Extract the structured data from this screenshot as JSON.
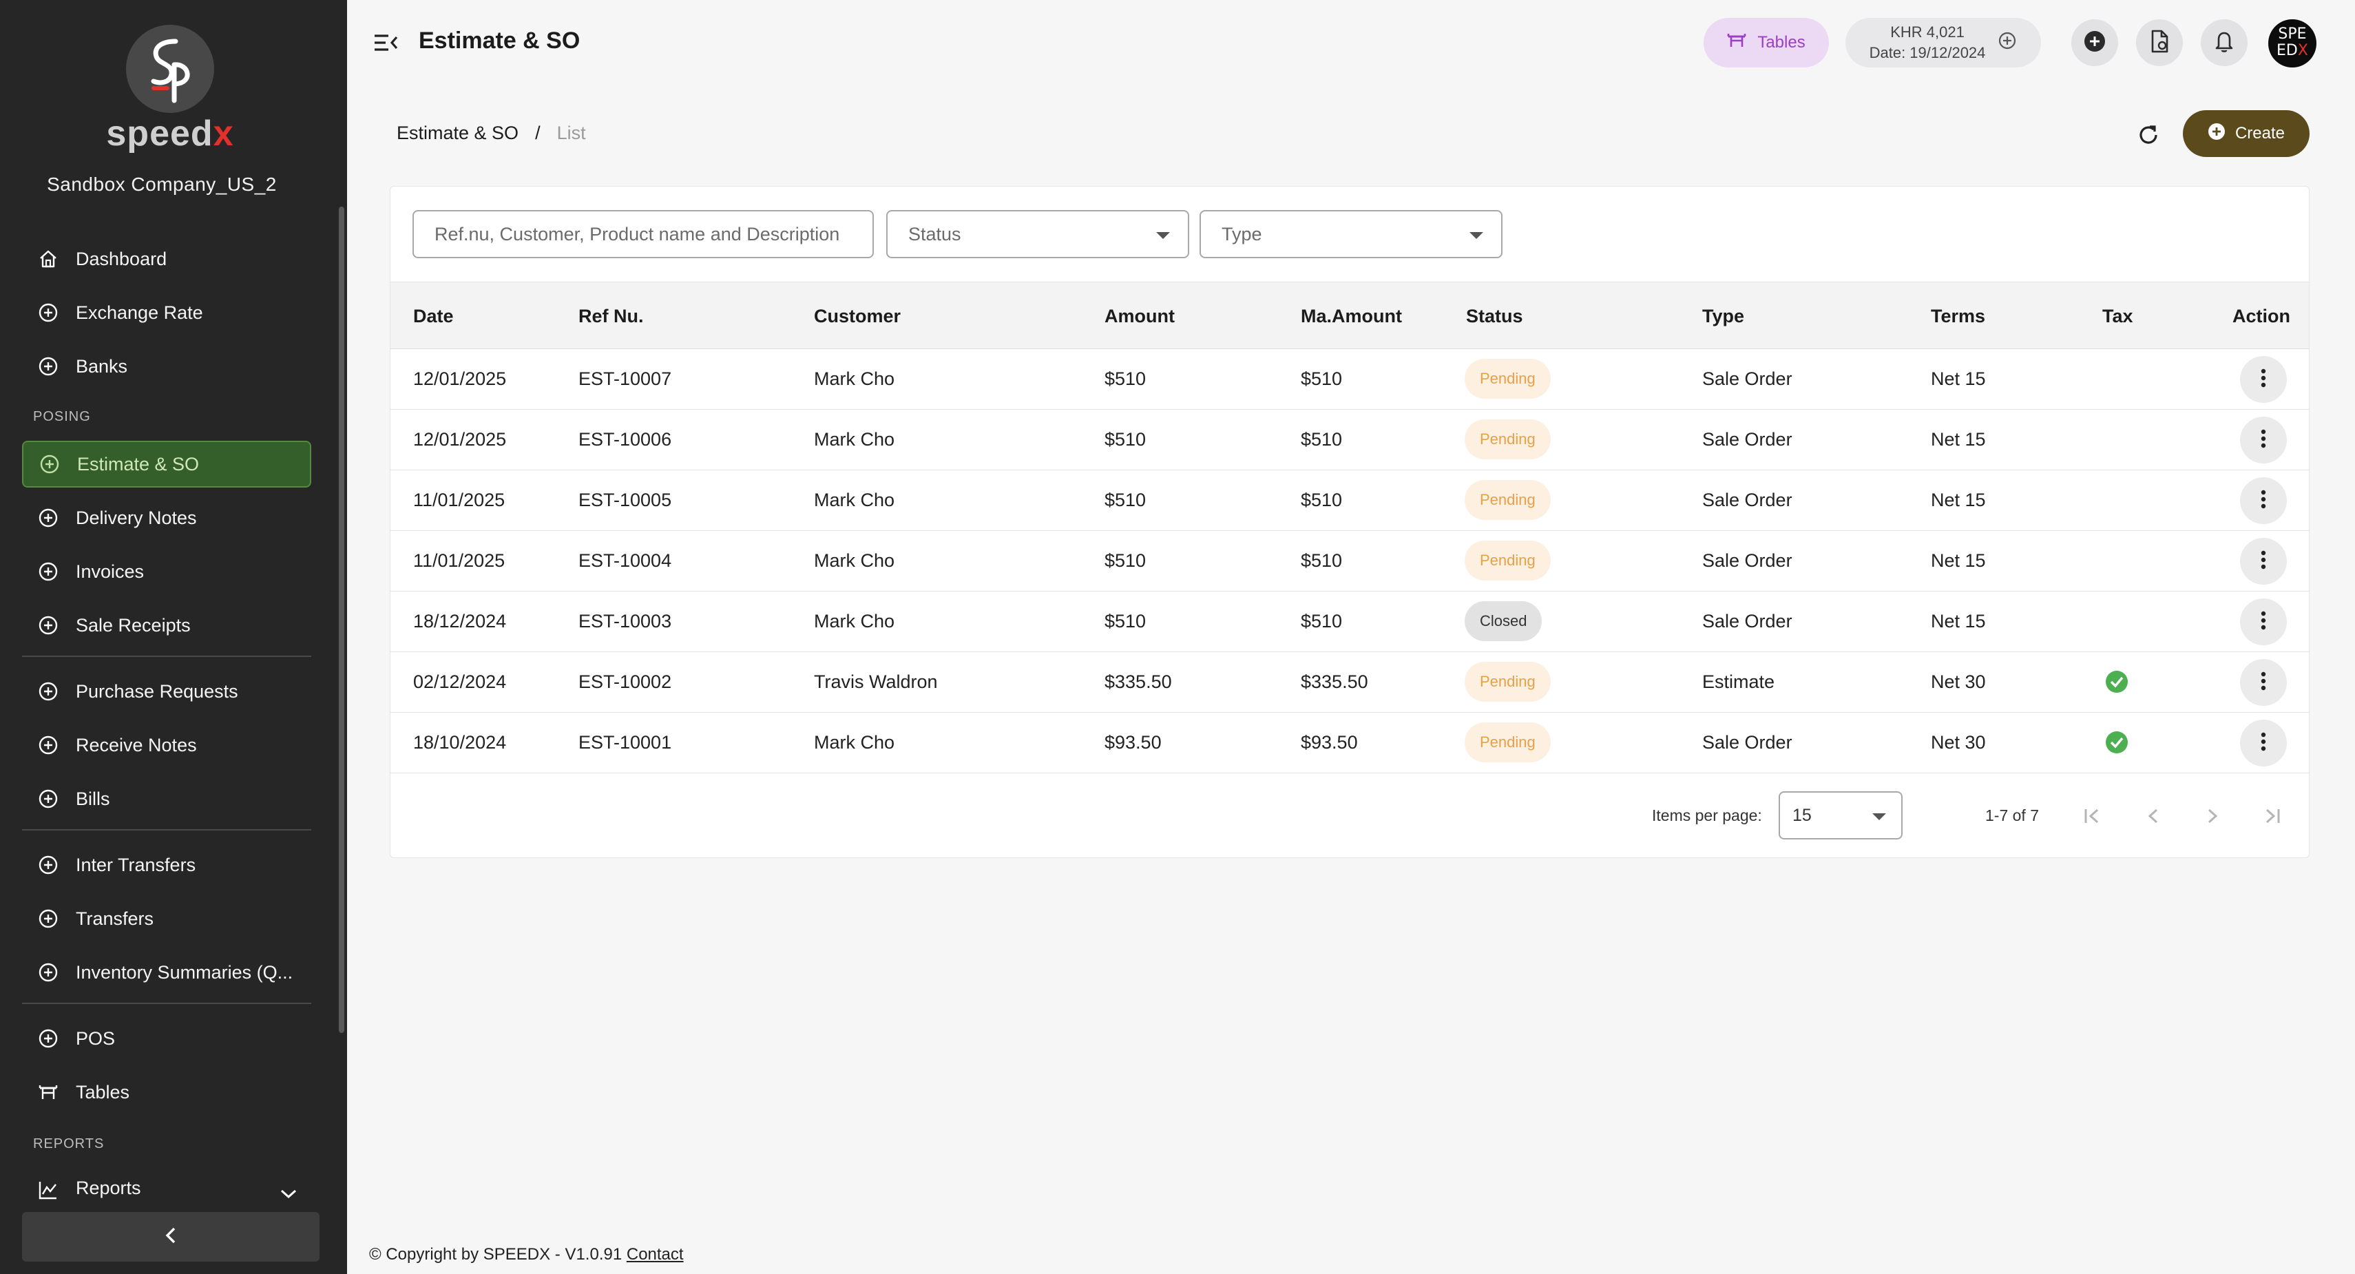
{
  "app": {
    "brand_logo_text": "S P",
    "brand_name_main": "speed",
    "brand_name_accent": "x",
    "company": "Sandbox Company_US_2"
  },
  "sidebar": {
    "items": [
      {
        "label": "Dashboard",
        "icon": "home-icon"
      },
      {
        "label": "Exchange Rate",
        "icon": "plus-circle-icon"
      },
      {
        "label": "Banks",
        "icon": "plus-circle-icon"
      },
      {
        "label": "Estimate & SO",
        "icon": "plus-circle-icon",
        "active": true
      },
      {
        "label": "Delivery Notes",
        "icon": "plus-circle-icon"
      },
      {
        "label": "Invoices",
        "icon": "plus-circle-icon"
      },
      {
        "label": "Sale Receipts",
        "icon": "plus-circle-icon"
      },
      {
        "label": "Purchase Requests",
        "icon": "plus-circle-icon"
      },
      {
        "label": "Receive Notes",
        "icon": "plus-circle-icon"
      },
      {
        "label": "Bills",
        "icon": "plus-circle-icon"
      },
      {
        "label": "Inter Transfers",
        "icon": "plus-circle-icon"
      },
      {
        "label": "Transfers",
        "icon": "plus-circle-icon"
      },
      {
        "label": "Inventory Summaries (Q...",
        "icon": "plus-circle-icon"
      },
      {
        "label": "POS",
        "icon": "plus-circle-icon"
      },
      {
        "label": "Tables",
        "icon": "table-icon"
      },
      {
        "label": "Reports",
        "icon": "chart-line-icon"
      }
    ],
    "sections": {
      "posing": "POSING",
      "reports": "REPORTS"
    }
  },
  "header": {
    "title": "Estimate & SO",
    "tables_label": "Tables",
    "rate_line1": "KHR 4,021",
    "rate_line2": "Date: 19/12/2024",
    "avatar_line1": "SPE",
    "avatar_line2a": "ED",
    "avatar_line2b": "X"
  },
  "breadcrumb": {
    "root": "Estimate & SO",
    "separator": "/",
    "current": "List"
  },
  "toolbar": {
    "create_label": "Create"
  },
  "filters": {
    "search_placeholder": "Ref.nu, Customer, Product name and Description",
    "status_placeholder": "Status",
    "type_placeholder": "Type"
  },
  "table": {
    "columns": [
      "Date",
      "Ref Nu.",
      "Customer",
      "Amount",
      "Ma.Amount",
      "Status",
      "Type",
      "Terms",
      "Tax",
      "Action"
    ],
    "rows": [
      {
        "date": "12/01/2025",
        "ref": "EST-10007",
        "customer": "Mark Cho",
        "amount": "$510",
        "ma_amount": "$510",
        "status": "Pending",
        "type": "Sale Order",
        "terms": "Net 15",
        "tax": false
      },
      {
        "date": "12/01/2025",
        "ref": "EST-10006",
        "customer": "Mark Cho",
        "amount": "$510",
        "ma_amount": "$510",
        "status": "Pending",
        "type": "Sale Order",
        "terms": "Net 15",
        "tax": false
      },
      {
        "date": "11/01/2025",
        "ref": "EST-10005",
        "customer": "Mark Cho",
        "amount": "$510",
        "ma_amount": "$510",
        "status": "Pending",
        "type": "Sale Order",
        "terms": "Net 15",
        "tax": false
      },
      {
        "date": "11/01/2025",
        "ref": "EST-10004",
        "customer": "Mark Cho",
        "amount": "$510",
        "ma_amount": "$510",
        "status": "Pending",
        "type": "Sale Order",
        "terms": "Net 15",
        "tax": false
      },
      {
        "date": "18/12/2024",
        "ref": "EST-10003",
        "customer": "Mark Cho",
        "amount": "$510",
        "ma_amount": "$510",
        "status": "Closed",
        "type": "Sale Order",
        "terms": "Net 15",
        "tax": false
      },
      {
        "date": "02/12/2024",
        "ref": "EST-10002",
        "customer": "Travis Waldron",
        "amount": "$335.50",
        "ma_amount": "$335.50",
        "status": "Pending",
        "type": "Estimate",
        "terms": "Net 30",
        "tax": true
      },
      {
        "date": "18/10/2024",
        "ref": "EST-10001",
        "customer": "Mark Cho",
        "amount": "$93.50",
        "ma_amount": "$93.50",
        "status": "Pending",
        "type": "Sale Order",
        "terms": "Net 30",
        "tax": true
      }
    ]
  },
  "pagination": {
    "items_per_page_label": "Items per page:",
    "items_per_page_value": "15",
    "range": "1-7 of 7"
  },
  "footer": {
    "copyright": "© Copyright by SPEEDX - V1.0.91",
    "contact": "Contact"
  },
  "colors": {
    "sidebar_bg": "#262626",
    "active_bg": "#345e2a",
    "create_bg": "#5b4a1c",
    "pending_text": "#e6a14a",
    "tax_check": "#4caf50",
    "brand_accent": "#e0312c"
  }
}
